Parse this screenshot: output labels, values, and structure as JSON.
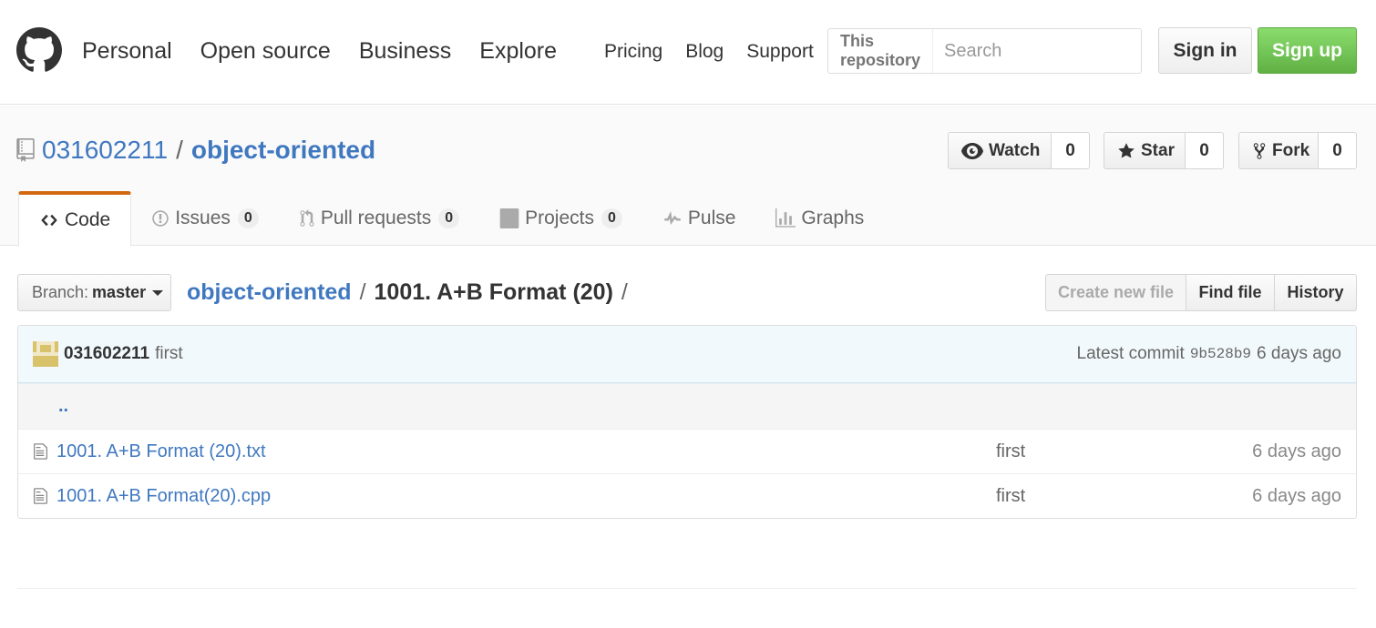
{
  "header": {
    "nav": [
      "Personal",
      "Open source",
      "Business",
      "Explore"
    ],
    "subnav": [
      "Pricing",
      "Blog",
      "Support"
    ],
    "search_scope": "This repository",
    "search_placeholder": "Search",
    "sign_in": "Sign in",
    "sign_up": "Sign up"
  },
  "repo": {
    "owner": "031602211",
    "separator": "/",
    "name": "object-oriented",
    "watch": {
      "label": "Watch",
      "count": "0"
    },
    "star": {
      "label": "Star",
      "count": "0"
    },
    "fork": {
      "label": "Fork",
      "count": "0"
    }
  },
  "tabs": [
    {
      "label": "Code",
      "icon": "code-icon",
      "selected": true
    },
    {
      "label": "Issues",
      "count": "0",
      "icon": "issue-icon"
    },
    {
      "label": "Pull requests",
      "count": "0",
      "icon": "pull-request-icon"
    },
    {
      "label": "Projects",
      "count": "0",
      "icon": "project-icon"
    },
    {
      "label": "Pulse",
      "icon": "pulse-icon"
    },
    {
      "label": "Graphs",
      "icon": "graph-icon"
    }
  ],
  "file_nav": {
    "branch_label": "Branch:",
    "branch": "master",
    "path_root": "object-oriented",
    "path_sep": "/",
    "path_current": "1001. A+B Format (20)",
    "path_trailing": "/",
    "create_new_file": "Create new file",
    "find_file": "Find file",
    "history": "History"
  },
  "commit": {
    "author": "031602211",
    "message": "first",
    "latest_label": "Latest commit",
    "sha": "9b528b9",
    "age": "6 days ago"
  },
  "files": {
    "up": "..",
    "rows": [
      {
        "name": "1001. A+B Format (20).txt",
        "message": "first",
        "age": "6 days ago"
      },
      {
        "name": "1001. A+B Format(20).cpp",
        "message": "first",
        "age": "6 days ago"
      }
    ]
  }
}
